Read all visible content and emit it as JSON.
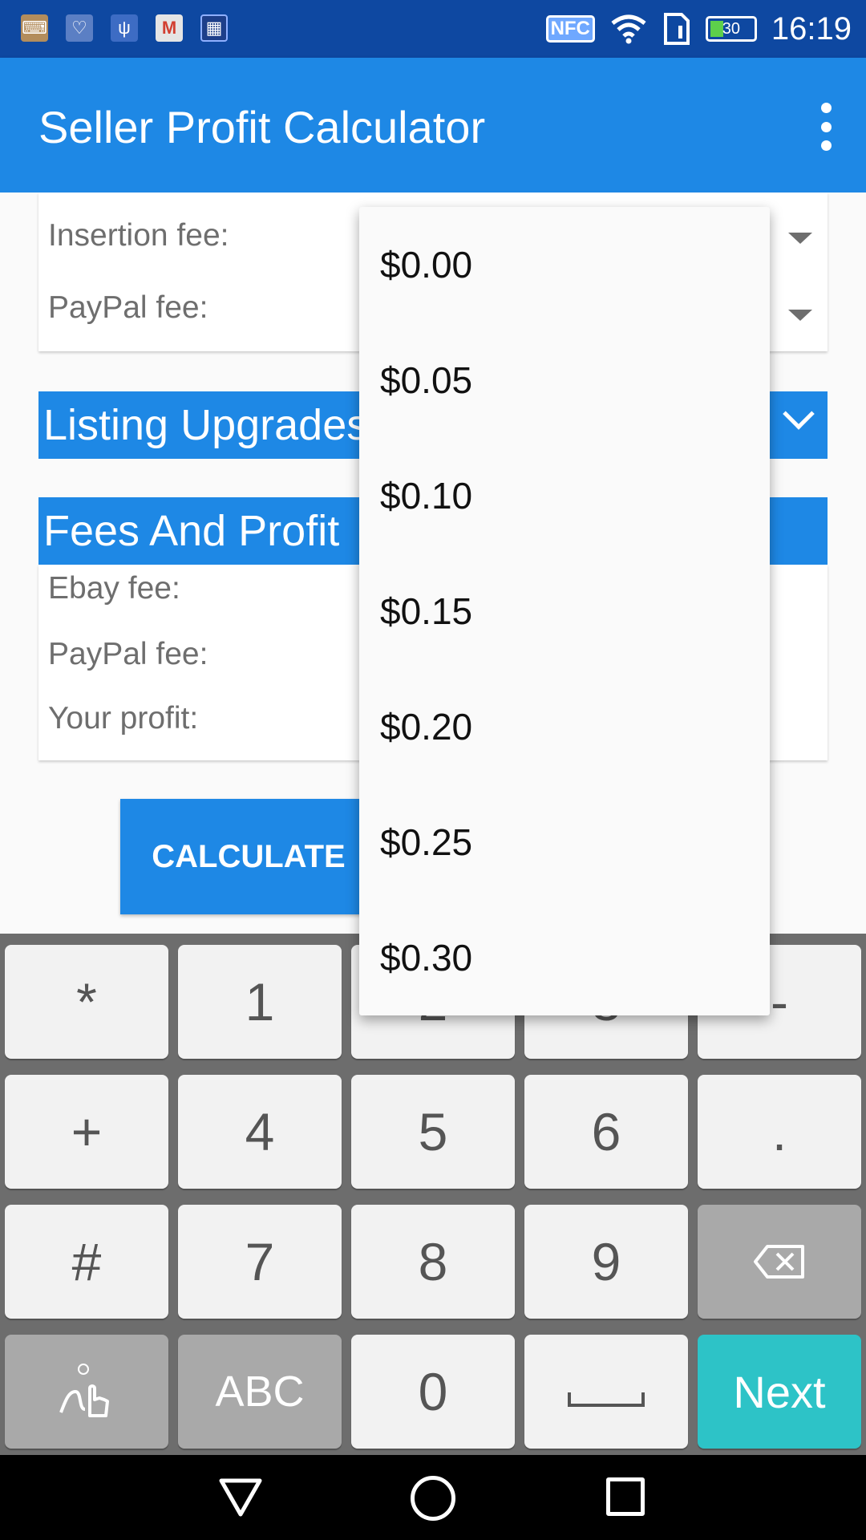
{
  "status_bar": {
    "time": "16:19",
    "battery": "30",
    "nfc": "NFC",
    "notification_icons": [
      "keyboard-icon",
      "health-icon",
      "usb-icon",
      "gmail-icon",
      "calculator-icon"
    ]
  },
  "app_bar": {
    "title": "Seller Profit Calculator"
  },
  "form": {
    "insertion_fee_label": "Insertion fee:",
    "paypal_fee_label": "PayPal fee:"
  },
  "listing_upgrades": {
    "title": "Listing Upgrades"
  },
  "fees_and_profit": {
    "title": "Fees And Profit",
    "ebay_fee_label": "Ebay fee:",
    "paypal_fee_label": "PayPal fee:",
    "profit_label": "Your profit:"
  },
  "calculate_button": {
    "label": "CALCULATE"
  },
  "dropdown": {
    "options": [
      "$0.00",
      "$0.05",
      "$0.10",
      "$0.15",
      "$0.20",
      "$0.25",
      "$0.30"
    ]
  },
  "keyboard": {
    "row1": [
      "*",
      "1",
      "2",
      "3",
      "-"
    ],
    "row2": [
      "+",
      "4",
      "5",
      "6",
      "."
    ],
    "row3": [
      "#",
      "7",
      "8",
      "9"
    ],
    "row4": {
      "abc": "ABC",
      "zero": "0",
      "next": "Next"
    }
  }
}
